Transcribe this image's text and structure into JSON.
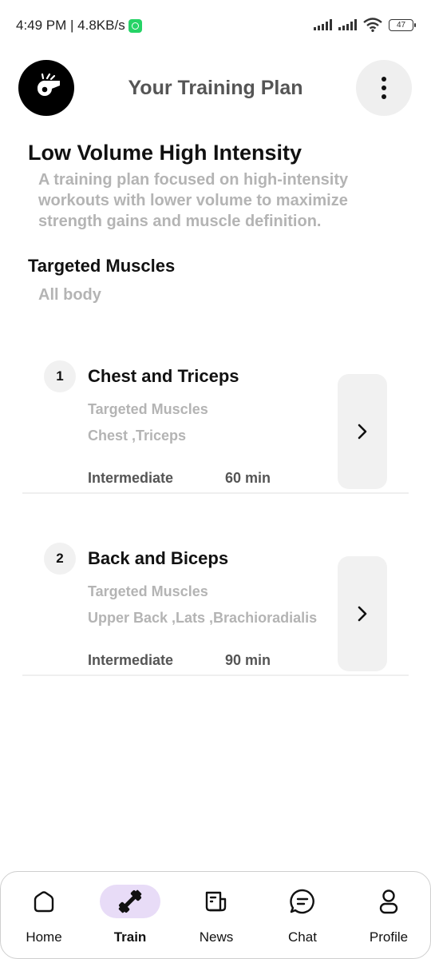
{
  "status_bar": {
    "time_speed": "4:49 PM | 4.8KB/s",
    "battery": "47"
  },
  "header": {
    "title": "Your Training Plan",
    "logo_icon": "whistle-icon",
    "menu_icon": "more-vertical-icon"
  },
  "plan": {
    "title": "Low Volume High Intensity",
    "description": "A training plan focused on high-intensity workouts with lower volume to maximize strength gains and muscle definition.",
    "targets_heading": "Targeted Muscles",
    "targets_value": "All body"
  },
  "workouts": [
    {
      "number": "1",
      "title": "Chest and Triceps",
      "sub_label": "Targeted Muscles",
      "muscles": "Chest ,Triceps",
      "level": "Intermediate",
      "duration": "60 min"
    },
    {
      "number": "2",
      "title": "Back and Biceps",
      "sub_label": "Targeted Muscles",
      "muscles": "Upper Back ,Lats ,Brachioradialis",
      "level": "Intermediate",
      "duration": "90 min"
    }
  ],
  "nav": {
    "items": [
      {
        "label": "Home",
        "icon": "home-icon",
        "active": false
      },
      {
        "label": "Train",
        "icon": "dumbbell-icon",
        "active": true
      },
      {
        "label": "News",
        "icon": "newspaper-icon",
        "active": false
      },
      {
        "label": "Chat",
        "icon": "chat-bubble-icon",
        "active": false
      },
      {
        "label": "Profile",
        "icon": "user-icon",
        "active": false
      }
    ]
  },
  "colors": {
    "active_nav_bg": "#e8dcf7",
    "muted_text": "#b4b4b4",
    "whatsapp": "#25d366"
  }
}
